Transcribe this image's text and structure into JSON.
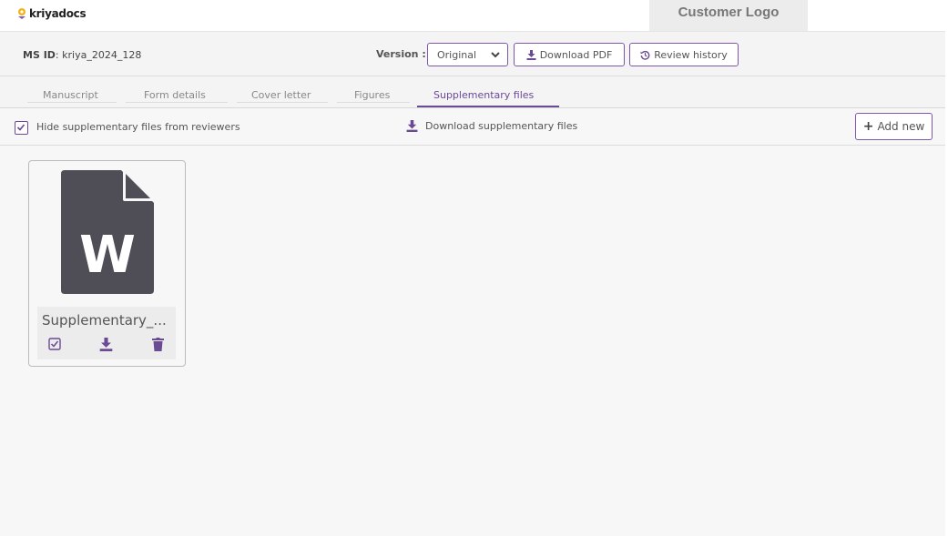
{
  "header": {
    "brand": "kriyadocs",
    "customer_logo": "Customer Logo"
  },
  "ms_bar": {
    "ms_id_label": "MS ID",
    "ms_id_value": ": kriya_2024_128",
    "version_label": "Version :",
    "version_selected": "Original",
    "download_pdf": "Download PDF",
    "review_history": "Review history"
  },
  "tabs": [
    {
      "label": "Manuscript"
    },
    {
      "label": "Form details"
    },
    {
      "label": "Cover letter"
    },
    {
      "label": "Figures"
    },
    {
      "label": "Supplementary files",
      "active": true
    }
  ],
  "toolbar": {
    "hide_label": "Hide supplementary files from reviewers",
    "hide_checked": true,
    "download_supp": "Download supplementary files",
    "add_new": "Add new"
  },
  "files": [
    {
      "name": "Supplementary_...",
      "icon": "word-document-icon",
      "letter": "W"
    }
  ],
  "colors": {
    "accent": "#6b4a95",
    "doc_icon": "#4f4d56",
    "background": "#f7f7f7"
  }
}
